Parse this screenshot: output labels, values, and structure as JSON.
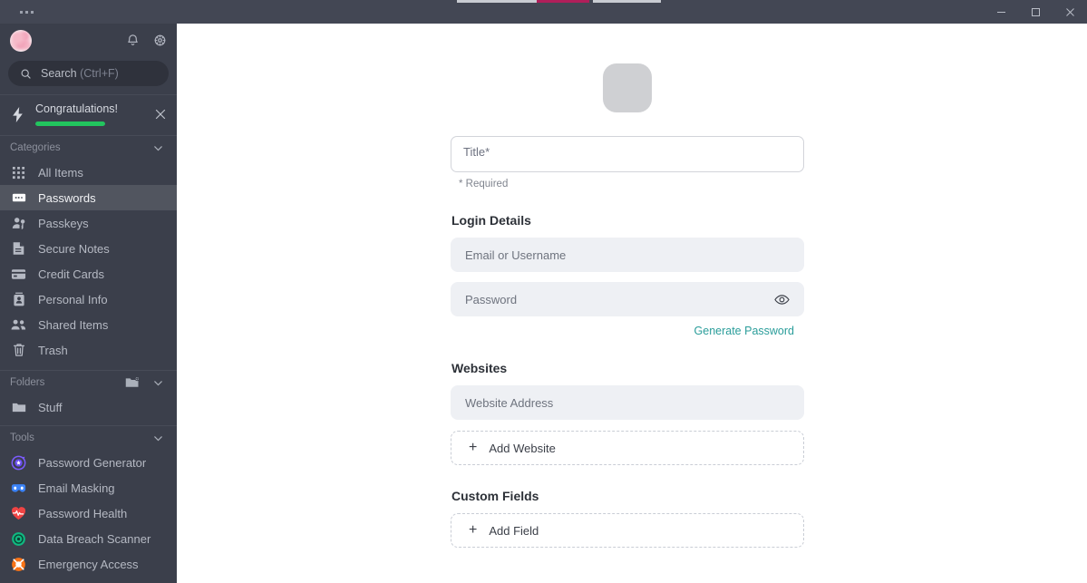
{
  "titlebar": {
    "overflow_menu": "•••",
    "minimize_label": "Minimize",
    "maximize_label": "Restore",
    "close_label": "Close"
  },
  "sidebar": {
    "notifications_label": "Notifications",
    "settings_label": "Settings",
    "search": {
      "label": "Search",
      "shortcut": "(Ctrl+F)"
    },
    "banner": {
      "title": "Congratulations!",
      "progress_percent": 100,
      "progress_color": "#22c55e",
      "close_label": "Dismiss"
    },
    "categories": {
      "header": "Categories",
      "items": [
        {
          "label": "All Items",
          "icon": "grid-icon",
          "active": false
        },
        {
          "label": "Passwords",
          "icon": "password-icon",
          "active": true
        },
        {
          "label": "Passkeys",
          "icon": "passkey-icon",
          "active": false
        },
        {
          "label": "Secure Notes",
          "icon": "note-icon",
          "active": false
        },
        {
          "label": "Credit Cards",
          "icon": "credit-card-icon",
          "active": false
        },
        {
          "label": "Personal Info",
          "icon": "id-card-icon",
          "active": false
        },
        {
          "label": "Shared Items",
          "icon": "people-icon",
          "active": false
        },
        {
          "label": "Trash",
          "icon": "trash-icon",
          "active": false
        }
      ]
    },
    "folders": {
      "header": "Folders",
      "add_folder_label": "New Folder",
      "items": [
        {
          "label": "Stuff",
          "icon": "folder-icon"
        }
      ]
    },
    "tools": {
      "header": "Tools",
      "items": [
        {
          "label": "Password Generator",
          "icon": "password-generator-icon",
          "color": "#7c5cff"
        },
        {
          "label": "Email Masking",
          "icon": "mask-icon",
          "color": "#3b82f6"
        },
        {
          "label": "Password Health",
          "icon": "heart-pulse-icon",
          "color": "#ef4444"
        },
        {
          "label": "Data Breach Scanner",
          "icon": "scanner-icon",
          "color": "#10b981"
        },
        {
          "label": "Emergency Access",
          "icon": "lifebuoy-icon",
          "color": "#f97316"
        }
      ]
    }
  },
  "main": {
    "thumbnail_placeholder": "item-icon-placeholder",
    "title_field": {
      "placeholder": "Title*",
      "value": ""
    },
    "required_note": "* Required",
    "login_details": {
      "heading": "Login Details",
      "username_placeholder": "Email or Username",
      "username_value": "",
      "password_placeholder": "Password",
      "password_value": "",
      "reveal_label": "Show password",
      "generate_label": "Generate Password",
      "generate_color": "#2a9d9a"
    },
    "websites": {
      "heading": "Websites",
      "address_placeholder": "Website Address",
      "address_value": "",
      "add_label": "Add Website",
      "add_symbol": "+"
    },
    "custom_fields": {
      "heading": "Custom Fields",
      "add_label": "Add Field",
      "add_symbol": "+"
    }
  }
}
